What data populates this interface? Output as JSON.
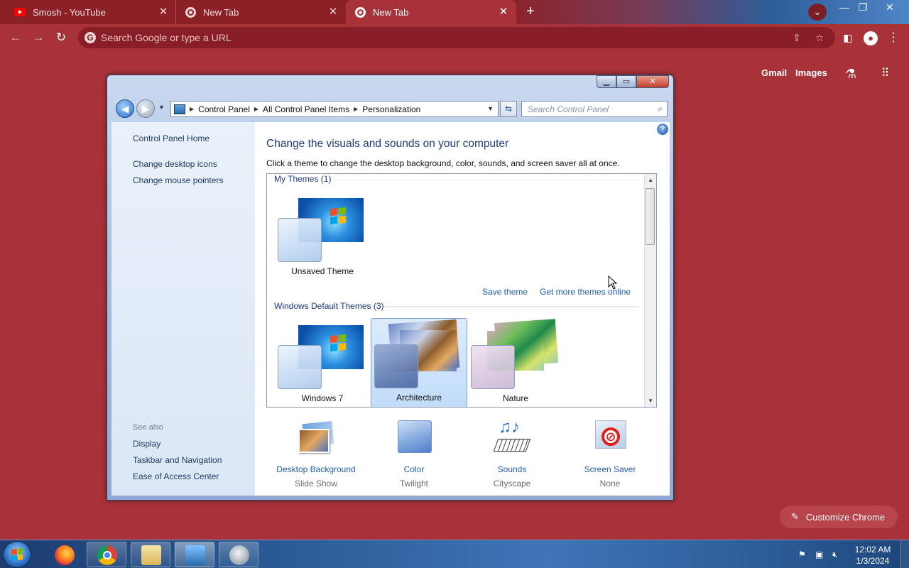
{
  "chrome": {
    "tabs": [
      {
        "title": "Smosh - YouTube",
        "icon": "youtube-icon"
      },
      {
        "title": "New Tab",
        "icon": "chrome-icon"
      },
      {
        "title": "New Tab",
        "icon": "chrome-icon",
        "active": true
      }
    ],
    "omnibox_placeholder": "Search Google or type a URL",
    "ntp_links": {
      "gmail": "Gmail",
      "images": "Images"
    },
    "customize_label": "Customize Chrome",
    "theme_color": "#a8323a"
  },
  "explorer": {
    "breadcrumb": [
      "Control Panel",
      "All Control Panel Items",
      "Personalization"
    ],
    "search_placeholder": "Search Control Panel",
    "left_links": [
      "Control Panel Home",
      "Change desktop icons",
      "Change mouse pointers"
    ],
    "see_also_label": "See also",
    "see_also_links": [
      "Display",
      "Taskbar and Navigation",
      "Ease of Access Center"
    ],
    "heading": "Change the visuals and sounds on your computer",
    "subtext": "Click a theme to change the desktop background, color, sounds, and screen saver all at once.",
    "my_themes_label": "My Themes (1)",
    "my_themes": [
      {
        "name": "Unsaved Theme"
      }
    ],
    "save_theme": "Save theme",
    "get_more_themes": "Get more themes online",
    "default_themes_label": "Windows Default Themes (3)",
    "default_themes": [
      {
        "name": "Windows 7"
      },
      {
        "name": "Architecture",
        "selected": true
      },
      {
        "name": "Nature"
      }
    ],
    "bottom_items": [
      {
        "title": "Desktop Background",
        "value": "Slide Show",
        "icon": "desktop-background-icon"
      },
      {
        "title": "Color",
        "value": "Twilight",
        "icon": "color-icon"
      },
      {
        "title": "Sounds",
        "value": "Cityscape",
        "icon": "sounds-icon"
      },
      {
        "title": "Screen Saver",
        "value": "None",
        "icon": "screen-saver-icon"
      }
    ]
  },
  "taskbar": {
    "time": "12:02 AM",
    "date": "1/3/2024",
    "apps": [
      "firefox-icon",
      "chrome-icon",
      "file-explorer-icon",
      "control-panel-icon",
      "media-icon"
    ]
  }
}
